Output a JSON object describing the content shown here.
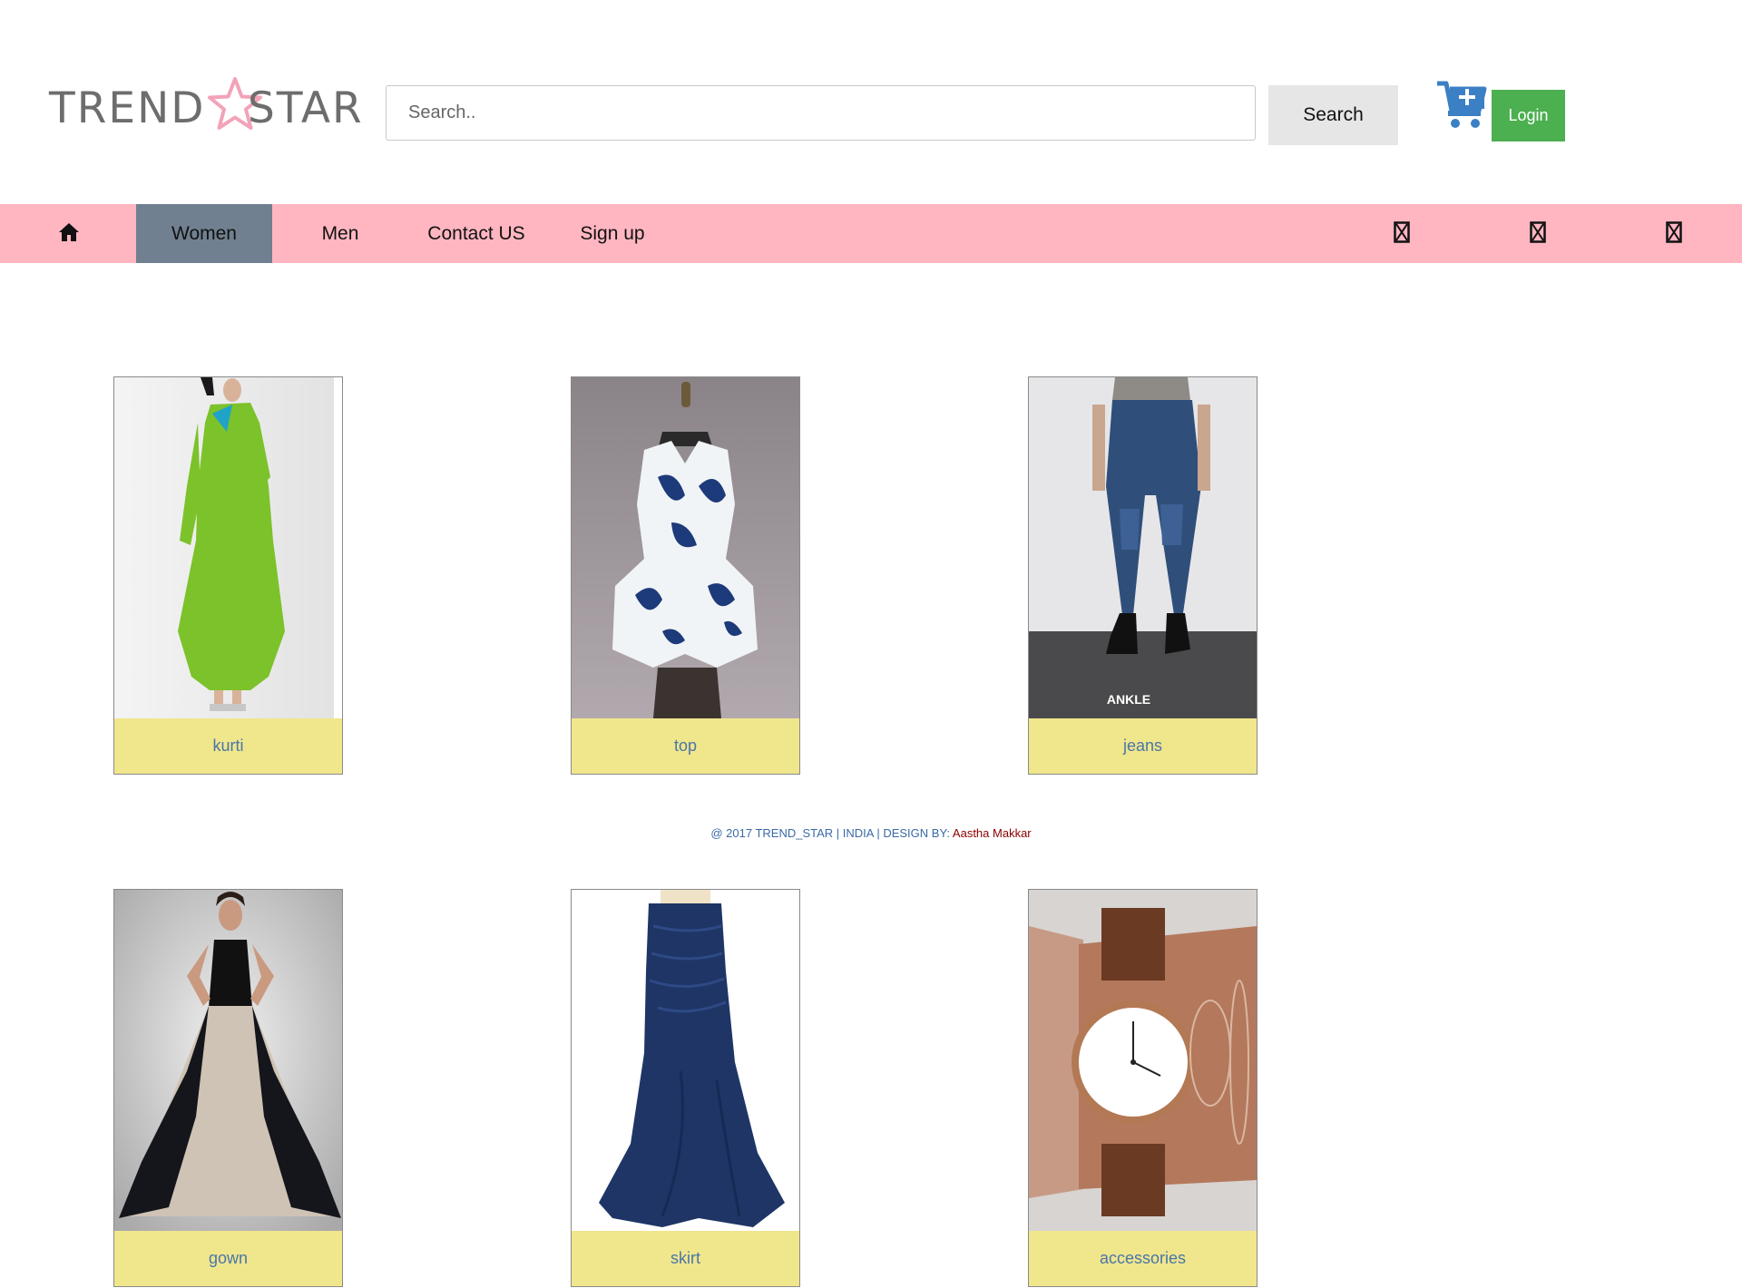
{
  "header": {
    "logo": {
      "left": "TREND",
      "right": "STAR",
      "star_color": "#f0a0b8"
    },
    "search": {
      "placeholder": "Search..",
      "value": "",
      "button_label": "Search"
    },
    "cart_icon": "shopping-cart-add",
    "login_label": "Login",
    "colors": {
      "login": "#4caf50",
      "search_button": "#e6e6e6",
      "cart": "#3b7fc4"
    }
  },
  "nav": {
    "background": "#ffb6c1",
    "active_background": "#708090",
    "home_icon": "home",
    "items": [
      {
        "label": "Women",
        "active": true
      },
      {
        "label": "Men",
        "active": false
      },
      {
        "label": "Contact US",
        "active": false
      },
      {
        "label": "Sign up",
        "active": false
      }
    ],
    "right_icons": [
      "missing-glyph",
      "missing-glyph",
      "missing-glyph"
    ]
  },
  "products": [
    {
      "label": "kurti"
    },
    {
      "label": "top"
    },
    {
      "label": "jeans",
      "image_overlay_text": "ANKLE"
    },
    {
      "label": "gown"
    },
    {
      "label": "skirt"
    },
    {
      "label": "accessories"
    }
  ],
  "footer": {
    "text": "@ 2017 TREND_STAR | INDIA | DESIGN BY: ",
    "author": "Aastha Makkar"
  },
  "colors": {
    "caption_background": "#f0e68c",
    "caption_text": "#4a76a8"
  }
}
